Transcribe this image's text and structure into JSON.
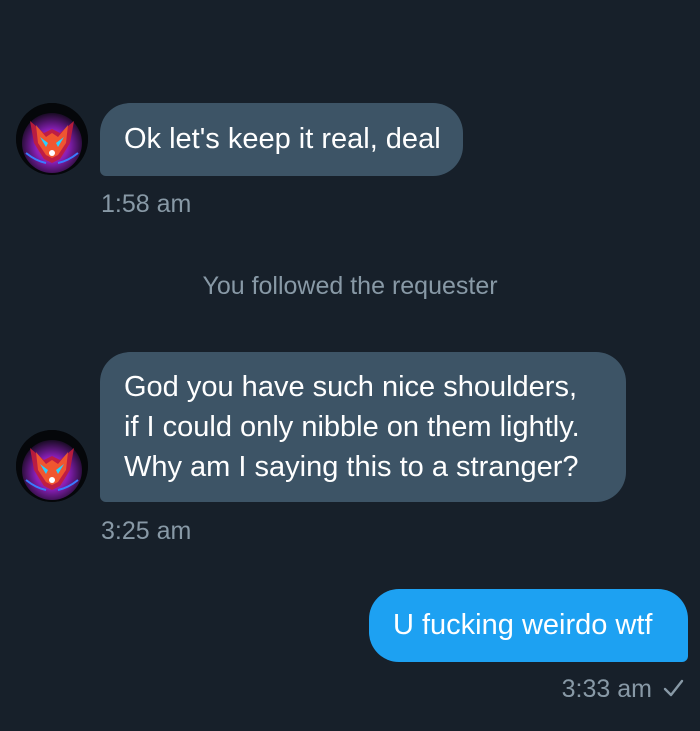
{
  "conversation": {
    "messages": [
      {
        "direction": "incoming",
        "lines": [
          "Ok let's keep it real, deal"
        ],
        "time": "1:58 am",
        "avatar_icon": "wolf-avatar-icon"
      },
      {
        "direction": "incoming",
        "lines": [
          "God you have such nice shoulders,",
          "if I could only nibble on them lightly.",
          "Why am I saying this to a stranger?"
        ],
        "time": "3:25 am",
        "avatar_icon": "wolf-avatar-icon"
      },
      {
        "direction": "outgoing",
        "lines": [
          "U fucking weirdo wtf"
        ],
        "time": "3:33 am",
        "status_icon": "checkmark-icon"
      }
    ],
    "system_note": "You followed the requester"
  },
  "colors": {
    "background": "#17202a",
    "incoming_bubble": "#3d5466",
    "outgoing_bubble": "#1da1f2",
    "meta_text": "#8899a6"
  }
}
